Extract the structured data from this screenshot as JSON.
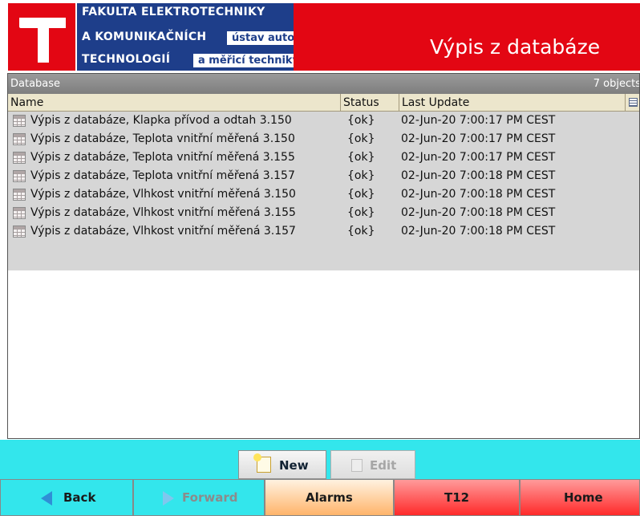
{
  "header": {
    "faculty_line1": "FAKULTA ELEKTROTECHNIKY",
    "faculty_line2": "A KOMUNIKAČNÍCH",
    "faculty_line3": "TECHNOLOGIÍ",
    "dept_line1": "ústav automatizace",
    "dept_line2": "a měřicí techniky",
    "title": "Výpis z databáze",
    "colors": {
      "brand_red": "#e30613",
      "brand_blue": "#1e3e8a"
    }
  },
  "panel": {
    "title": "Database",
    "count": "7 objects",
    "columns": {
      "name": "Name",
      "status": "Status",
      "last_update": "Last Update"
    },
    "options_icon": "column-options-icon",
    "rows": [
      {
        "name": "Výpis z databáze, Klapka přívod a odtah 3.150",
        "status": "{ok}",
        "last_update": "02-Jun-20 7:00:17 PM CEST"
      },
      {
        "name": "Výpis z databáze, Teplota vnitřní měřená 3.150",
        "status": "{ok}",
        "last_update": "02-Jun-20 7:00:17 PM CEST"
      },
      {
        "name": "Výpis z databáze, Teplota vnitřní měřená 3.155",
        "status": "{ok}",
        "last_update": "02-Jun-20 7:00:17 PM CEST"
      },
      {
        "name": "Výpis z databáze, Teplota vnitřní měřená 3.157",
        "status": "{ok}",
        "last_update": "02-Jun-20 7:00:18 PM CEST"
      },
      {
        "name": "Výpis z databáze, Vlhkost vnitřní měřená 3.150",
        "status": "{ok}",
        "last_update": "02-Jun-20 7:00:18 PM CEST"
      },
      {
        "name": "Výpis z databáze, Vlhkost vnitřní měřená 3.155",
        "status": "{ok}",
        "last_update": "02-Jun-20 7:00:18 PM CEST"
      },
      {
        "name": "Výpis z databáze, Vlhkost vnitřní měřená 3.157",
        "status": "{ok}",
        "last_update": "02-Jun-20 7:00:18 PM CEST"
      }
    ]
  },
  "actions": {
    "new_label": "New",
    "edit_label": "Edit"
  },
  "nav": {
    "back": "Back",
    "forward": "Forward",
    "alarms": "Alarms",
    "t12": "T12",
    "home": "Home"
  }
}
